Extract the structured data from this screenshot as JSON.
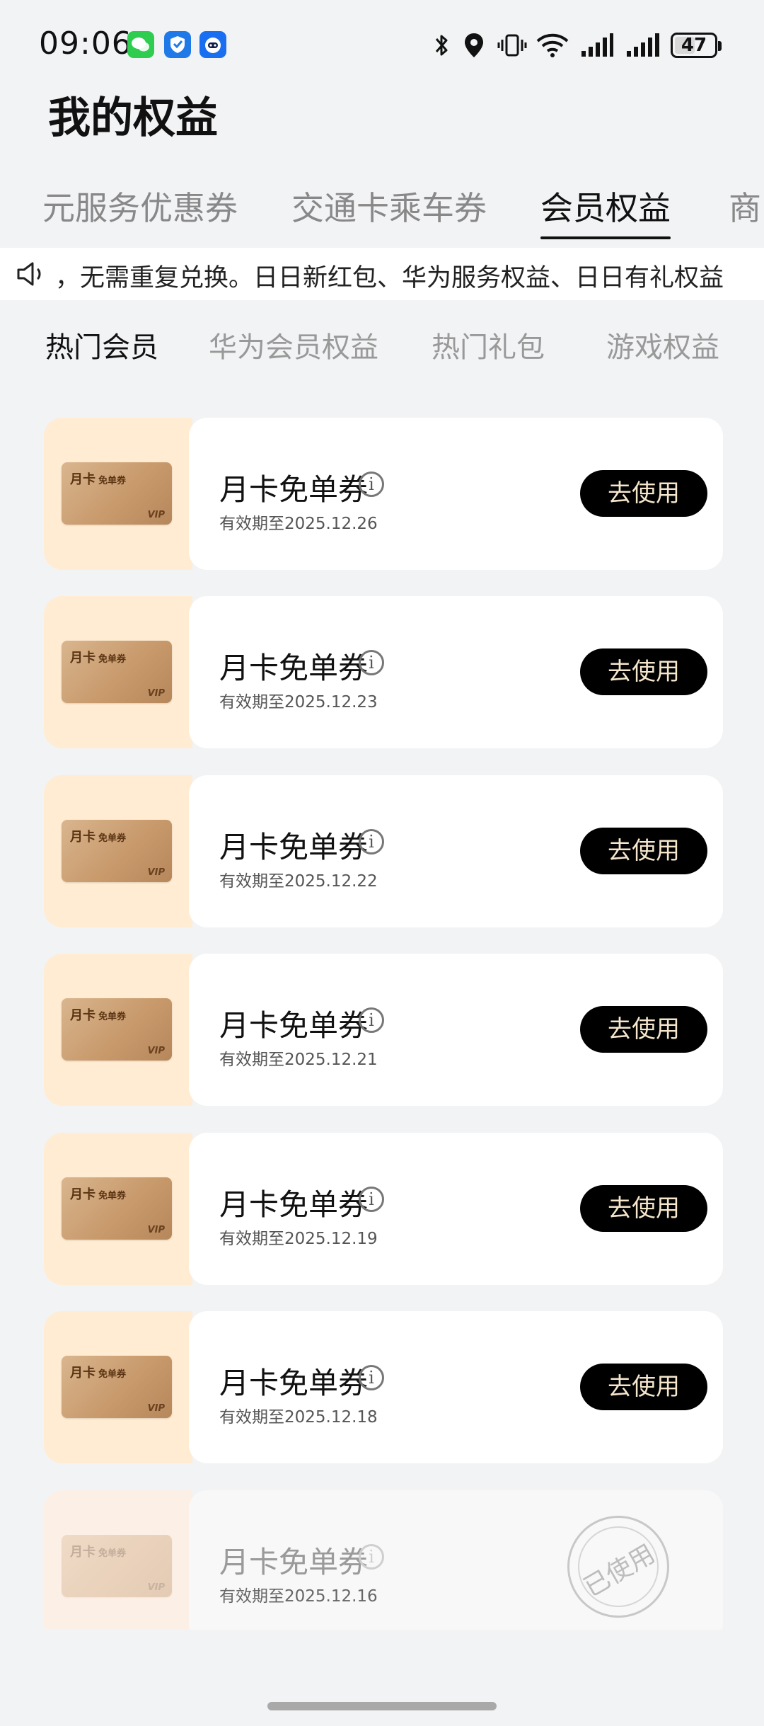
{
  "status_bar": {
    "time": "09:06",
    "battery": "47",
    "icons": [
      "wechat-icon",
      "shield-app-icon",
      "bot-app-icon",
      "bluetooth-icon",
      "location-icon",
      "vibrate-icon",
      "wifi-icon",
      "signal-icon",
      "signal-icon-2"
    ]
  },
  "page": {
    "title": "我的权益"
  },
  "tabs": [
    {
      "label": "元服务优惠券",
      "active": false
    },
    {
      "label": "交通卡乘车券",
      "active": false
    },
    {
      "label": "会员权益",
      "active": true
    },
    {
      "label": "商",
      "active": false
    }
  ],
  "notice": {
    "text": "，无需重复兑换。日日新红包、华为服务权益、日日有礼权益"
  },
  "subtabs": [
    {
      "label": "热门会员",
      "active": true
    },
    {
      "label": "华为会员权益",
      "active": false
    },
    {
      "label": "热门礼包",
      "active": false
    },
    {
      "label": "游戏权益",
      "active": false
    }
  ],
  "card_art": {
    "line1": "月卡",
    "line1_small": "免单券",
    "badge": "VIP"
  },
  "cards": [
    {
      "name": "月卡免单券",
      "info": "i",
      "expiry": "有效期至2025.12.26",
      "action": "去使用"
    },
    {
      "name": "月卡免单券",
      "info": "i",
      "expiry": "有效期至2025.12.23",
      "action": "去使用"
    },
    {
      "name": "月卡免单券",
      "info": "i",
      "expiry": "有效期至2025.12.22",
      "action": "去使用"
    },
    {
      "name": "月卡免单券",
      "info": "i",
      "expiry": "有效期至2025.12.21",
      "action": "去使用"
    },
    {
      "name": "月卡免单券",
      "info": "i",
      "expiry": "有效期至2025.12.19",
      "action": "去使用"
    },
    {
      "name": "月卡免单券",
      "info": "i",
      "expiry": "有效期至2025.12.18",
      "action": "去使用"
    },
    {
      "name": "月卡免单券",
      "info": "i",
      "expiry": "有效期至2025.12.16",
      "stamp": "已使用"
    }
  ],
  "colors": {
    "background": "#f2f3f5",
    "thumb_bg": "#ffecd3",
    "button_bg": "#000000",
    "button_text": "#f5e6cc"
  }
}
